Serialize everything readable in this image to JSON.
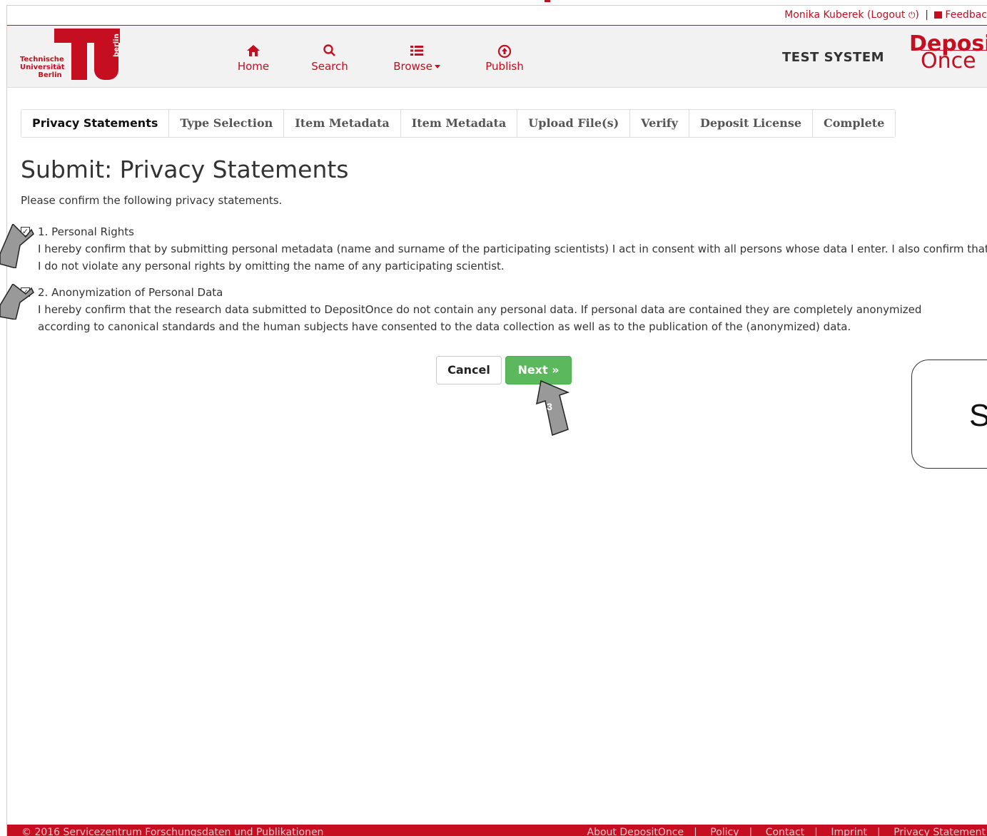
{
  "userbar": {
    "user": "Monika Kuberek",
    "logout": "(Logout",
    "logout_close": ")",
    "separator": "|",
    "feedback": "Feedbac"
  },
  "logo": {
    "text_line1": "Technische",
    "text_line2": "Universität",
    "text_line3": "Berlin",
    "vertical": "berlin"
  },
  "nav": {
    "home": "Home",
    "search": "Search",
    "browse": "Browse",
    "publish": "Publish"
  },
  "header": {
    "test_system": "TEST SYSTEM",
    "brand_line1": "Deposit",
    "brand_line2": "Once"
  },
  "steps": [
    "Privacy Statements",
    "Type Selection",
    "Item Metadata",
    "Item Metadata",
    "Upload File(s)",
    "Verify",
    "Deposit License",
    "Complete"
  ],
  "main": {
    "title": "Submit: Privacy Statements",
    "intro": "Please confirm the following privacy statements."
  },
  "statements": [
    {
      "heading": "1. Personal Rights",
      "body": "I hereby confirm that by submitting personal metadata (name and surname of the participating scientists) I act in consent with all persons whose data I enter. I also confirm that I do not violate any personal rights by omitting the name of any participating scientist.",
      "checked": true
    },
    {
      "heading": "2. Anonymization of Personal Data",
      "body": "I hereby confirm that the research data submitted to DepositOnce do not contain any personal data. If personal data are contained they are completely anonymized according to canonical standards and the human subjects have consented to the data collection as well as to the publication of the (anonymized) data.",
      "checked": true
    }
  ],
  "buttons": {
    "cancel": "Cancel",
    "next": "Next »"
  },
  "annotations": {
    "arrow_label": "3",
    "callout_text": "S"
  },
  "footer": {
    "copyright": "© 2016 Servicezentrum Forschungsdaten und Publikationen",
    "links": [
      "About DepositOnce",
      "Policy",
      "Contact",
      "Imprint",
      "Privacy Statement"
    ]
  },
  "colors": {
    "brand_red": "#c50e1f",
    "success_green": "#5cb85c"
  }
}
